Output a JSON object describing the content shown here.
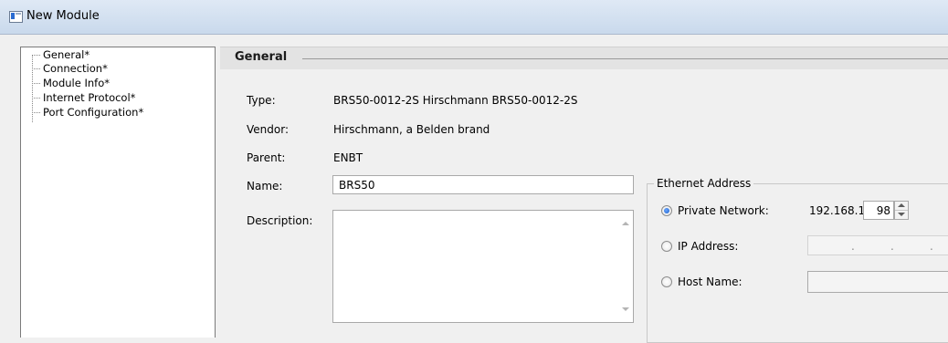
{
  "window": {
    "title": "New Module"
  },
  "nav_tree": {
    "items": [
      {
        "label": "General*"
      },
      {
        "label": "Connection*"
      },
      {
        "label": "Module Info*"
      },
      {
        "label": "Internet Protocol*"
      },
      {
        "label": "Port Configuration*"
      }
    ]
  },
  "section": {
    "title": "General"
  },
  "general": {
    "type_label": "Type:",
    "type_value": "BRS50-0012-2S Hirschmann BRS50-0012-2S",
    "vendor_label": "Vendor:",
    "vendor_value": "Hirschmann, a Belden brand",
    "parent_label": "Parent:",
    "parent_value": "ENBT",
    "name_label": "Name:",
    "name_value": "BRS50",
    "description_label": "Description:",
    "description_value": ""
  },
  "ethernet": {
    "group_label": "Ethernet Address",
    "private_network_label": "Private Network:",
    "private_network_selected": true,
    "private_prefix": "192.168.1.",
    "private_octet": "98",
    "ip_address_label": "IP Address:",
    "ip_address_selected": false,
    "host_name_label": "Host Name:",
    "host_name_selected": false,
    "host_name_value": ""
  },
  "icons": {
    "app": "module-window-icon",
    "spin_up": "spin-up-arrow-icon",
    "spin_down": "spin-down-arrow-icon",
    "scroll_up": "scroll-up-arrow-icon",
    "scroll_down": "scroll-down-arrow-icon"
  },
  "colors": {
    "titlebar": "#c9d9ec",
    "section_header": "#e3e3e3",
    "radio_selected": "#1a5fc8"
  }
}
